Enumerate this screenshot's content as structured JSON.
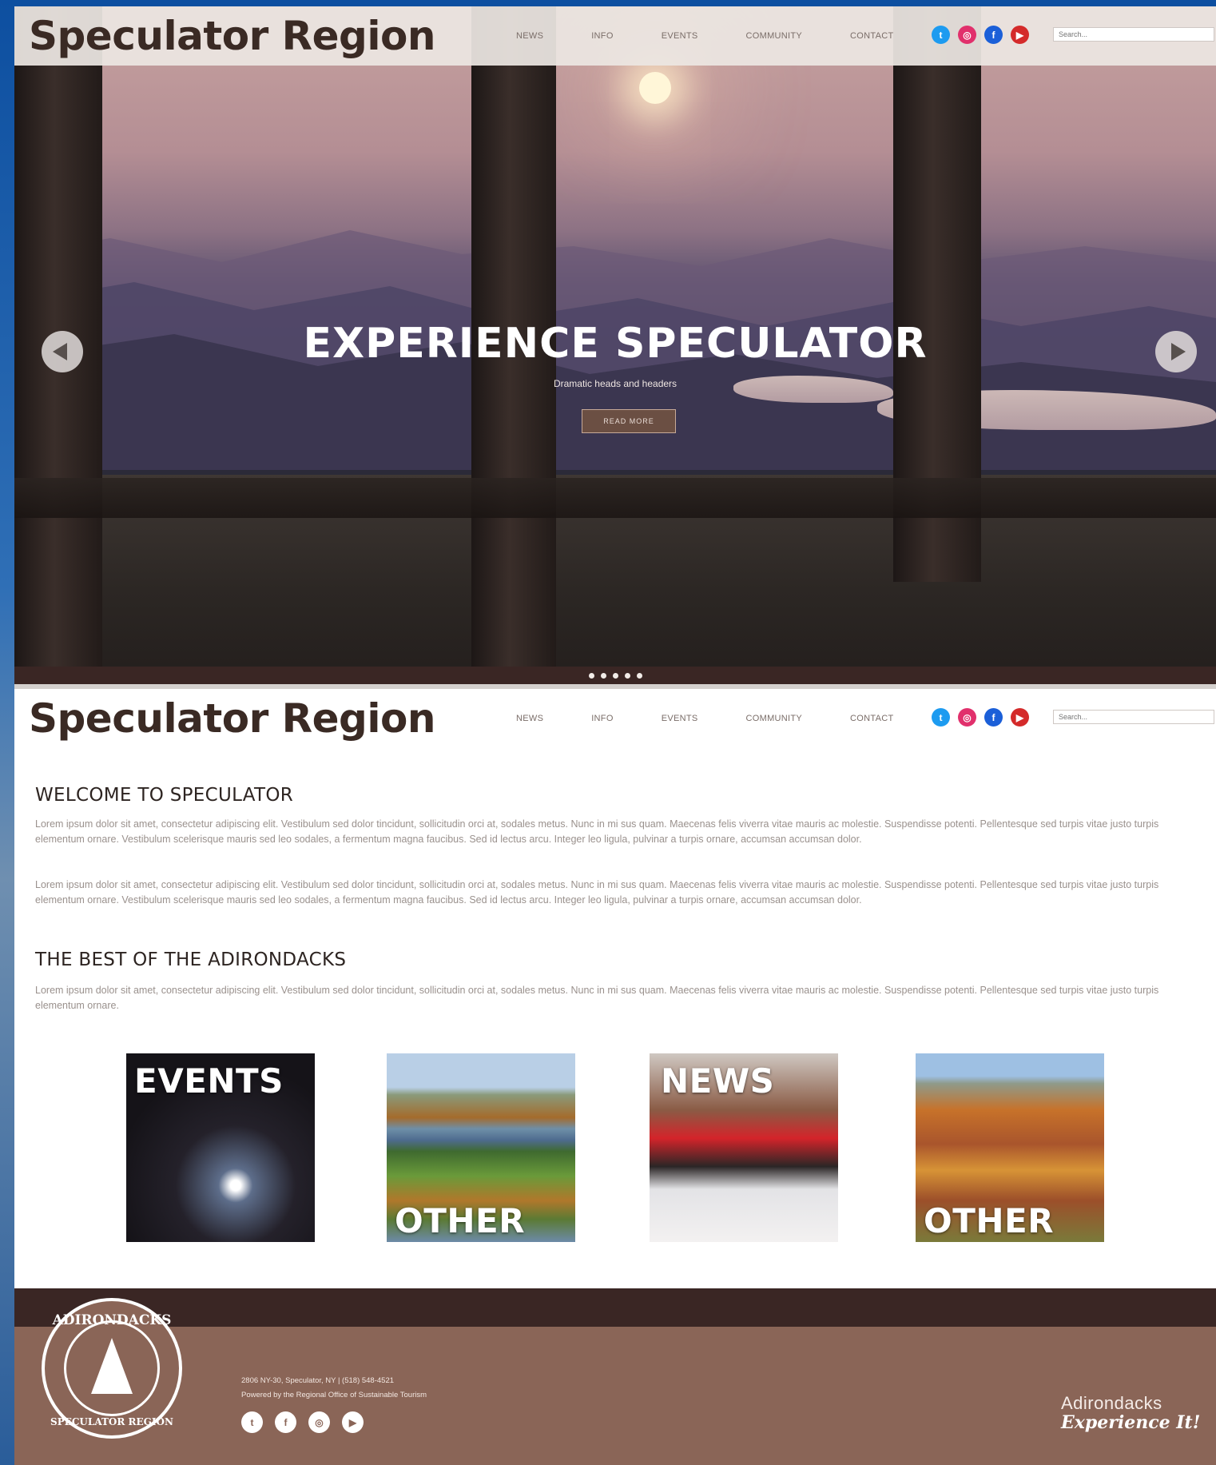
{
  "site_title": "Speculator Region",
  "nav": [
    "NEWS",
    "INFO",
    "EVENTS",
    "COMMUNITY",
    "CONTACT"
  ],
  "search_placeholder": "Search...",
  "social": [
    {
      "icon": "twitter-icon",
      "glyph": "t"
    },
    {
      "icon": "instagram-icon",
      "glyph": "◎"
    },
    {
      "icon": "facebook-icon",
      "glyph": "f"
    },
    {
      "icon": "youtube-icon",
      "glyph": "▶"
    }
  ],
  "hero": {
    "title": "EXPERIENCE SPECULATOR",
    "subtitle": "Dramatic heads and headers",
    "button": "READ MORE",
    "slide_count": 5
  },
  "welcome": {
    "heading": "WELCOME TO SPECULATOR",
    "p1": "Lorem ipsum dolor sit amet, consectetur adipiscing elit. Vestibulum sed dolor tincidunt, sollicitudin orci at, sodales metus. Nunc in mi sus quam. Maecenas felis viverra vitae mauris ac molestie. Suspendisse potenti. Pellentesque sed turpis vitae justo turpis elementum ornare. Vestibulum scelerisque mauris sed leo sodales, a fermentum magna faucibus. Sed id lectus arcu. Integer leo ligula, pulvinar a turpis ornare, accumsan accumsan dolor.",
    "p2": "Lorem ipsum dolor sit amet, consectetur adipiscing elit. Vestibulum sed dolor tincidunt, sollicitudin orci at, sodales metus. Nunc in mi sus quam. Maecenas felis viverra vitae mauris ac molestie. Suspendisse potenti. Pellentesque sed turpis vitae justo turpis elementum ornare. Vestibulum scelerisque mauris sed leo sodales, a fermentum magna faucibus. Sed id lectus arcu. Integer leo ligula, pulvinar a turpis ornare, accumsan accumsan dolor."
  },
  "best": {
    "heading": "THE BEST OF THE ADIRONDACKS",
    "p1": "Lorem ipsum dolor sit amet, consectetur adipiscing elit. Vestibulum sed dolor tincidunt, sollicitudin orci at, sodales metus. Nunc in mi sus quam. Maecenas felis viverra vitae mauris ac molestie. Suspendisse potenti. Pellentesque sed turpis vitae justo turpis elementum ornare."
  },
  "tiles": [
    {
      "label": "EVENTS"
    },
    {
      "label": "OTHER"
    },
    {
      "label": "NEWS"
    },
    {
      "label": "OTHER"
    }
  ],
  "footer": {
    "seal_top": "ADIRONDACKS",
    "seal_bottom": "SPECULATOR REGION",
    "address": "2806 NY-30, Speculator, NY | (518) 548-4521",
    "powered": "Powered by the Regional Office of Sustainable Tourism",
    "brand_line1": "Adirondacks",
    "brand_line2": "Experience It!"
  }
}
